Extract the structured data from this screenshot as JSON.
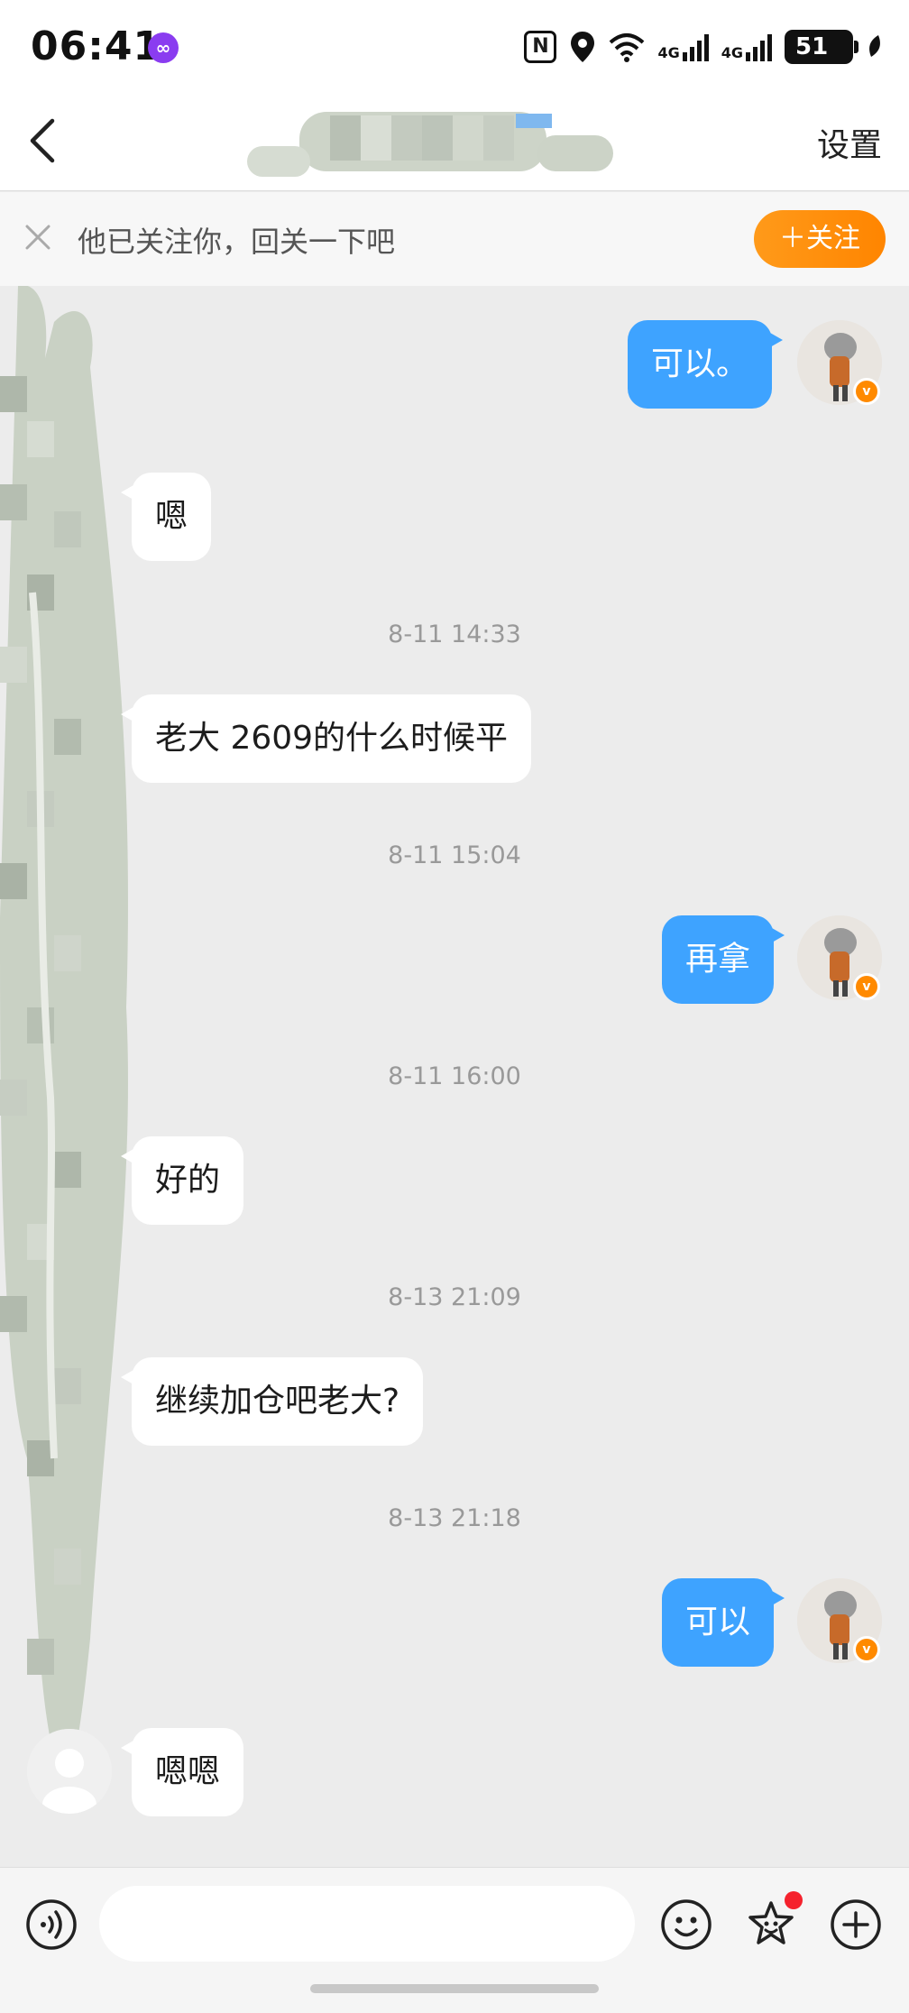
{
  "status_bar": {
    "time": "06:41",
    "signal_1": "4G",
    "signal_2": "4G",
    "battery": "51"
  },
  "header": {
    "settings_label": "设置"
  },
  "banner": {
    "text": "他已关注你，回关一下吧",
    "follow_label": "＋关注"
  },
  "messages": [
    {
      "side": "out",
      "text": "可以。"
    },
    {
      "side": "in",
      "text": "嗯"
    },
    {
      "type": "time",
      "text": "8-11 14:33"
    },
    {
      "side": "in",
      "text": "老大 2609的什么时候平"
    },
    {
      "type": "time",
      "text": "8-11 15:04"
    },
    {
      "side": "out",
      "text": "再拿"
    },
    {
      "type": "time",
      "text": "8-11 16:00"
    },
    {
      "side": "in",
      "text": "好的"
    },
    {
      "type": "time",
      "text": "8-13 21:09"
    },
    {
      "side": "in",
      "text": "继续加仓吧老大?"
    },
    {
      "type": "time",
      "text": "8-13 21:18"
    },
    {
      "side": "out",
      "text": "可以"
    },
    {
      "side": "in",
      "text": "嗯嗯"
    }
  ],
  "colors": {
    "outgoing_bubble": "#3ea3ff",
    "follow_button": "#ff8a00",
    "badge": "#ff8a00"
  },
  "input_bar": {
    "icons": [
      "voice-icon",
      "emoji-icon",
      "sticker-icon",
      "plus-icon"
    ],
    "placeholder": ""
  }
}
